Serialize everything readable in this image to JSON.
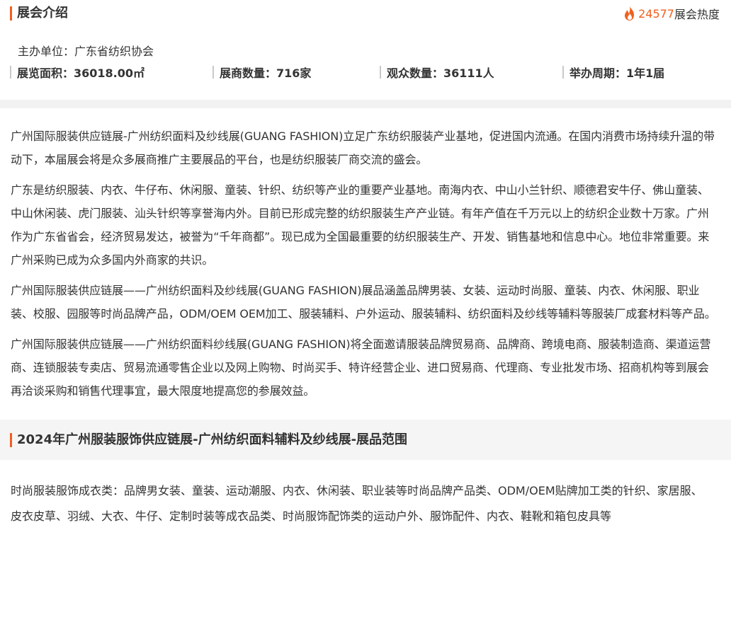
{
  "intro": {
    "title": "展会介绍",
    "heat_count": "24577",
    "heat_label": "展会热度",
    "organizer": "主办单位：广东省纺织协会",
    "stats": [
      "展览面积：36018.00㎡",
      "展商数量：716家",
      "观众数量：36111人",
      "举办周期：1年1届"
    ]
  },
  "description": {
    "paragraphs": [
      "广州国际服装供应链展-广州纺织面料及纱线展(GUANG FASHION)立足广东纺织服装产业基地，促进国内流通。在国内消费市场持续升温的带动下，本届展会将是众多展商推广主要展品的平台，也是纺织服装厂商交流的盛会。",
      "广东是纺织服装、内衣、牛仔布、休闲服、童装、针织、纺织等产业的重要产业基地。南海内衣、中山小兰针织、顺德君安牛仔、佛山童装、中山休闲装、虎门服装、汕头针织等享誉海内外。目前已形成完整的纺织服装生产产业链。有年产值在千万元以上的纺织企业数十万家。广州作为广东省省会，经济贸易发达，被誉为“千年商都”。现已成为全国最重要的纺织服装生产、开发、销售基地和信息中心。地位非常重要。来广州采购已成为众多国内外商家的共识。",
      "广州国际服装供应链展——广州纺织面料及纱线展(GUANG FASHION)展品涵盖品牌男装、女装、运动时尚服、童装、内衣、休闲服、职业装、校服、园服等时尚品牌产品，ODM/OEM OEM加工、服装辅料、户外运动、服装辅料、纺织面料及纱线等辅料等服装厂成套材料等产品。",
      "广州国际服装供应链展——广州纺织面料纱线展(GUANG FASHION)将全面邀请服装品牌贸易商、品牌商、跨境电商、服装制造商、渠道运营商、连锁服装专卖店、贸易流通零售企业以及网上购物、时尚买手、特许经营企业、进口贸易商、代理商、专业批发市场、招商机构等到展会再洽谈采购和销售代理事宜，最大限度地提高您的参展效益。"
    ]
  },
  "range": {
    "title": "2024年广州服装服饰供应链展-广州纺织面料辅料及纱线展-展品范围",
    "paragraph": "时尚服装服饰成衣类：品牌男女装、童装、运动潮服、内衣、休闲装、职业装等时尚品牌产品类、ODM/OEM贴牌加工类的针织、家居服、皮衣皮草、羽绒、大衣、牛仔、定制时装等成衣品类、时尚服饰配饰类的运动户外、服饰配件、内衣、鞋靴和箱包皮具等"
  },
  "colors": {
    "accent": "#f0601e",
    "text": "#333333",
    "divider": "#c9c9c9",
    "band": "#f2f2f2"
  }
}
